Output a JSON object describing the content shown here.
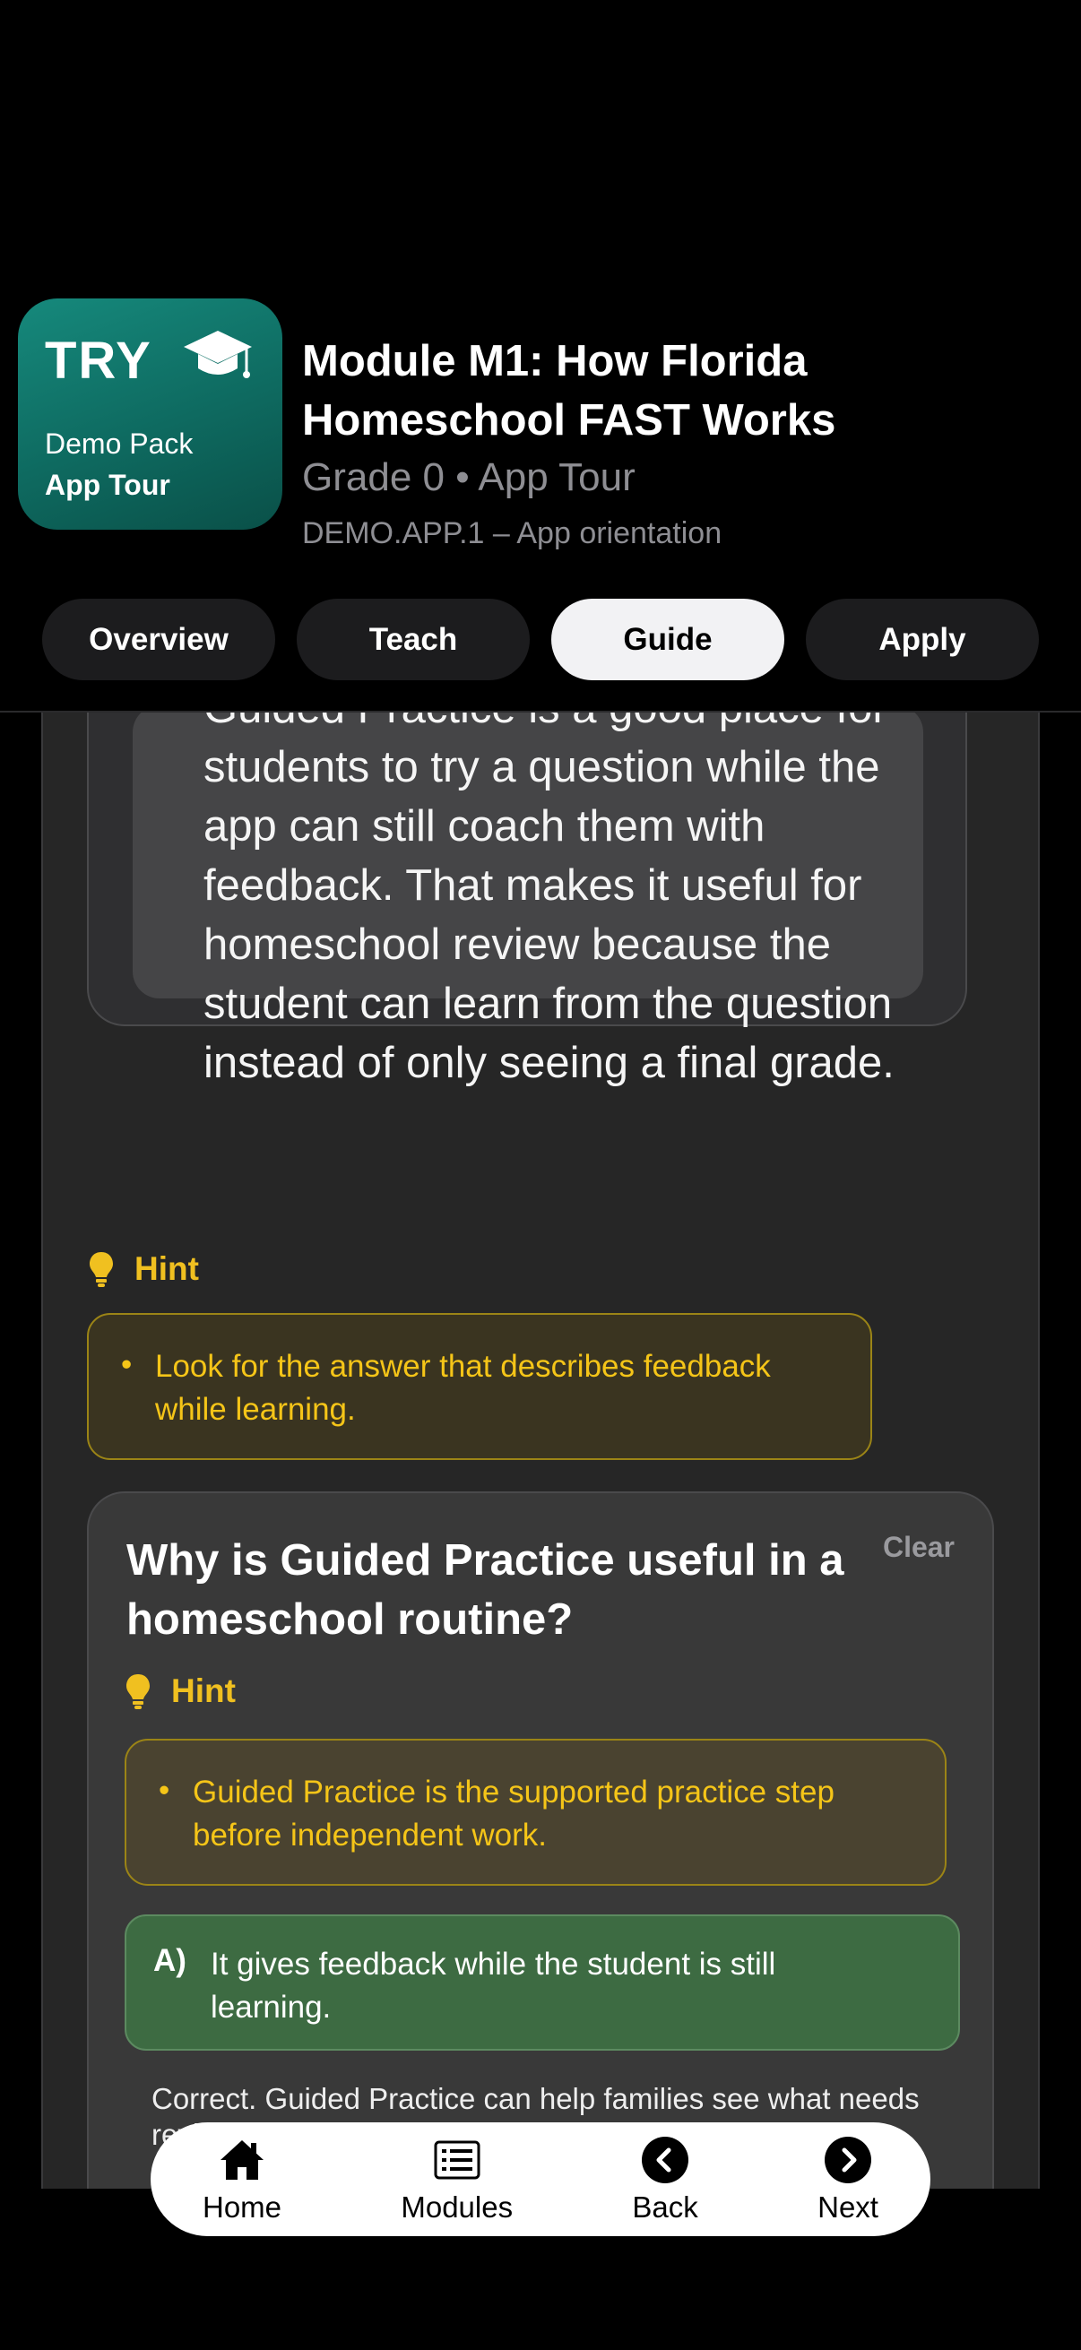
{
  "header": {
    "icon": {
      "badge": "TRY",
      "line1": "Demo Pack",
      "line2": "App Tour",
      "cap_icon": "graduation-cap-icon"
    },
    "title": "Module M1: How Florida Homeschool FAST Works",
    "subtitle": "Grade 0 • App Tour",
    "code": "DEMO.APP.1 – App orientation",
    "tabs": [
      {
        "label": "Overview"
      },
      {
        "label": "Teach"
      },
      {
        "label": "Guide"
      },
      {
        "label": "Apply"
      }
    ],
    "active_tab": "Guide"
  },
  "passage": {
    "text": "Guided Practice is a good place for students to try a question while the app can still coach them with feedback. That makes it useful for homeschool review because the student can learn from the question instead of only seeing a final grade."
  },
  "hint1": {
    "label": "Hint",
    "item": "Look for the answer that describes feedback while learning."
  },
  "question": {
    "title": "Why is Guided Practice useful in a homeschool routine?",
    "clear_label": "Clear",
    "hint_label": "Hint",
    "hint_item": "Guided Practice is the supported practice step before independent work.",
    "option_a": {
      "letter": "A)",
      "text": "It gives feedback while the student is still learning."
    },
    "feedback": "Correct. Guided Practice can help families see what needs review before independent work."
  },
  "bottom_nav": {
    "home": "Home",
    "modules": "Modules",
    "back": "Back",
    "next": "Next"
  },
  "colors": {
    "accent_teal": "#0e6a60",
    "hint_yellow": "#f0c020",
    "correct_green": "#3d6b42",
    "background": "#000000"
  }
}
